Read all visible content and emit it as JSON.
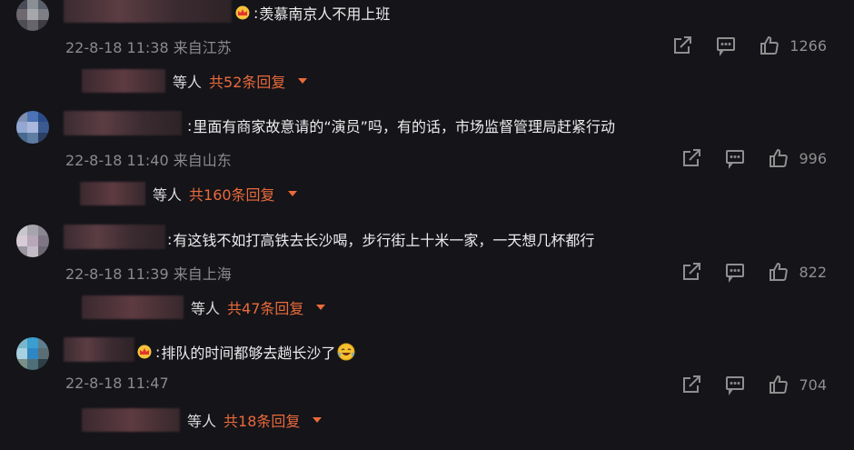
{
  "comments": [
    {
      "text": "羡慕南京人不用上班",
      "time": "22-8-18 11:38",
      "location": "来自江苏",
      "likes": "1266",
      "reply_suffix": "等人",
      "reply_count": "共52条回复",
      "has_crown": true
    },
    {
      "text": "里面有商家故意请的“演员”吗，有的话，市场监督管理局赶紧行动",
      "time": "22-8-18 11:40",
      "location": "来自山东",
      "likes": "996",
      "reply_suffix": "等人",
      "reply_count": "共160条回复",
      "has_crown": false
    },
    {
      "text": "有这钱不如打高铁去长沙喝，步行街上十米一家，一天想几杯都行",
      "time": "22-8-18 11:39",
      "location": "来自上海",
      "likes": "822",
      "reply_suffix": "等人",
      "reply_count": "共47条回复",
      "has_crown": false
    },
    {
      "text": "排队的时间都够去趟长沙了",
      "time": "22-8-18 11:47",
      "location": "",
      "likes": "704",
      "reply_suffix": "等人",
      "reply_count": "共18条回复",
      "has_crown": true,
      "emoji": "crying-laughing-emoji"
    }
  ],
  "colors": {
    "background": "#141419",
    "accent": "#ea6a3a",
    "meta": "#8b8b8b"
  }
}
